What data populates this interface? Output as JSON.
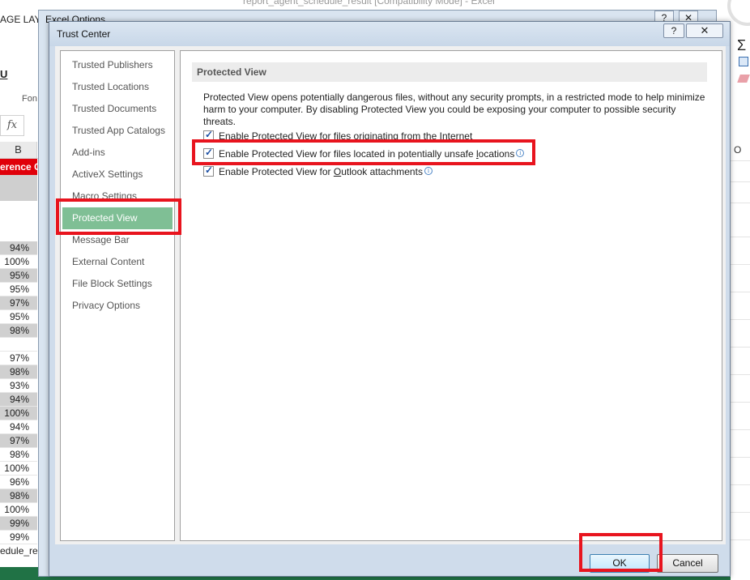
{
  "background": {
    "window_title": "report_agent_schedule_result  [Compatibility Mode] - Excel",
    "ribbon_tab": "AGE LAY",
    "underline_button": "U",
    "font_group": "Fon",
    "fx_label": "fx",
    "column_b": "B",
    "column_o": "O",
    "red_header": "erence C",
    "sigma": "Σ",
    "sheet_tab": "edule_re",
    "cells": [
      {
        "value": "94%",
        "shaded": true
      },
      {
        "value": "100%",
        "shaded": false
      },
      {
        "value": "95%",
        "shaded": true
      },
      {
        "value": "95%",
        "shaded": false
      },
      {
        "value": "97%",
        "shaded": true
      },
      {
        "value": "95%",
        "shaded": false
      },
      {
        "value": "98%",
        "shaded": true
      },
      {
        "value": "",
        "shaded": false
      },
      {
        "value": "97%",
        "shaded": false
      },
      {
        "value": "98%",
        "shaded": true
      },
      {
        "value": "93%",
        "shaded": false
      },
      {
        "value": "94%",
        "shaded": true
      },
      {
        "value": "100%",
        "shaded": true
      },
      {
        "value": "94%",
        "shaded": false
      },
      {
        "value": "97%",
        "shaded": true
      },
      {
        "value": "98%",
        "shaded": false
      },
      {
        "value": "100%",
        "shaded": false
      },
      {
        "value": "96%",
        "shaded": false
      },
      {
        "value": "98%",
        "shaded": true
      },
      {
        "value": "100%",
        "shaded": false
      },
      {
        "value": "99%",
        "shaded": true
      },
      {
        "value": "99%",
        "shaded": false
      }
    ]
  },
  "excel_options": {
    "title": "Excel Options",
    "help": "?",
    "close": "✕"
  },
  "trust_center": {
    "title": "Trust Center",
    "help": "?",
    "close": "✕",
    "nav": [
      "Trusted Publishers",
      "Trusted Locations",
      "Trusted Documents",
      "Trusted App Catalogs",
      "Add-ins",
      "ActiveX Settings",
      "Macro Settings",
      "Protected View",
      "Message Bar",
      "External Content",
      "File Block Settings",
      "Privacy Options"
    ],
    "selected_nav": "Protected View",
    "section_heading": "Protected View",
    "description": "Protected View opens potentially dangerous files, without any security prompts, in a restricted mode to help minimize harm to your computer. By disabling Protected View you could be exposing your computer to possible security threats.",
    "options": [
      {
        "pre": "Enable Protected View for files ",
        "ul": "o",
        "post": "riginating from the Internet",
        "checked": true,
        "info": false
      },
      {
        "pre": "Enable Protected View for files located in potentially unsafe ",
        "ul": "l",
        "post": "ocations",
        "checked": true,
        "info": true
      },
      {
        "pre": "Enable Protected View for ",
        "ul": "O",
        "post": "utlook attachments",
        "checked": true,
        "info": true
      }
    ],
    "ok_label": "OK",
    "cancel_label": "Cancel"
  }
}
